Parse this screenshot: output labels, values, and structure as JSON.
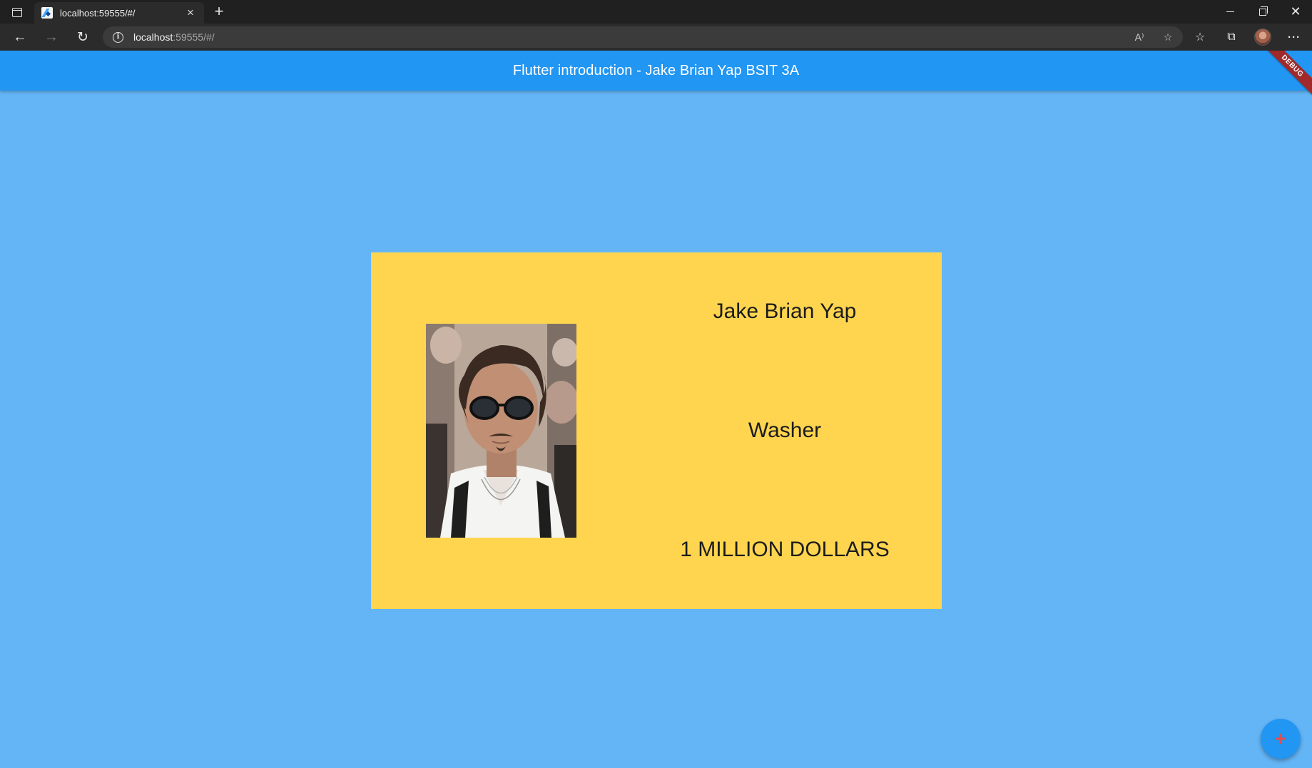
{
  "browser": {
    "tab": {
      "title": "localhost:59555/#/",
      "close_glyph": "×"
    },
    "new_tab_glyph": "+",
    "address": {
      "host": "localhost",
      "rest": ":59555/#/"
    },
    "icons": {
      "tab_actions": "tab-actions-icon",
      "back": "←",
      "forward": "→",
      "refresh": "↻",
      "info": "i",
      "read_aloud": "A⁾",
      "add_favorite": "☆",
      "favorites": "☆",
      "collections": "⧉",
      "more": "···",
      "window_close": "✕"
    }
  },
  "app": {
    "appbar_title": "Flutter introduction - Jake Brian Yap BSIT 3A",
    "debug_banner": "DEBUG",
    "card": {
      "name": "Jake Brian Yap",
      "job": "Washer",
      "salary": "1 MILLION DOLLARS"
    },
    "fab_icon": "+",
    "colors": {
      "background": "#64b5f6",
      "appbar": "#2196f3",
      "card": "#ffd54f",
      "fab": "#2196f3",
      "fab_icon": "#e74c4c",
      "debug_banner": "#a02a2a"
    }
  }
}
